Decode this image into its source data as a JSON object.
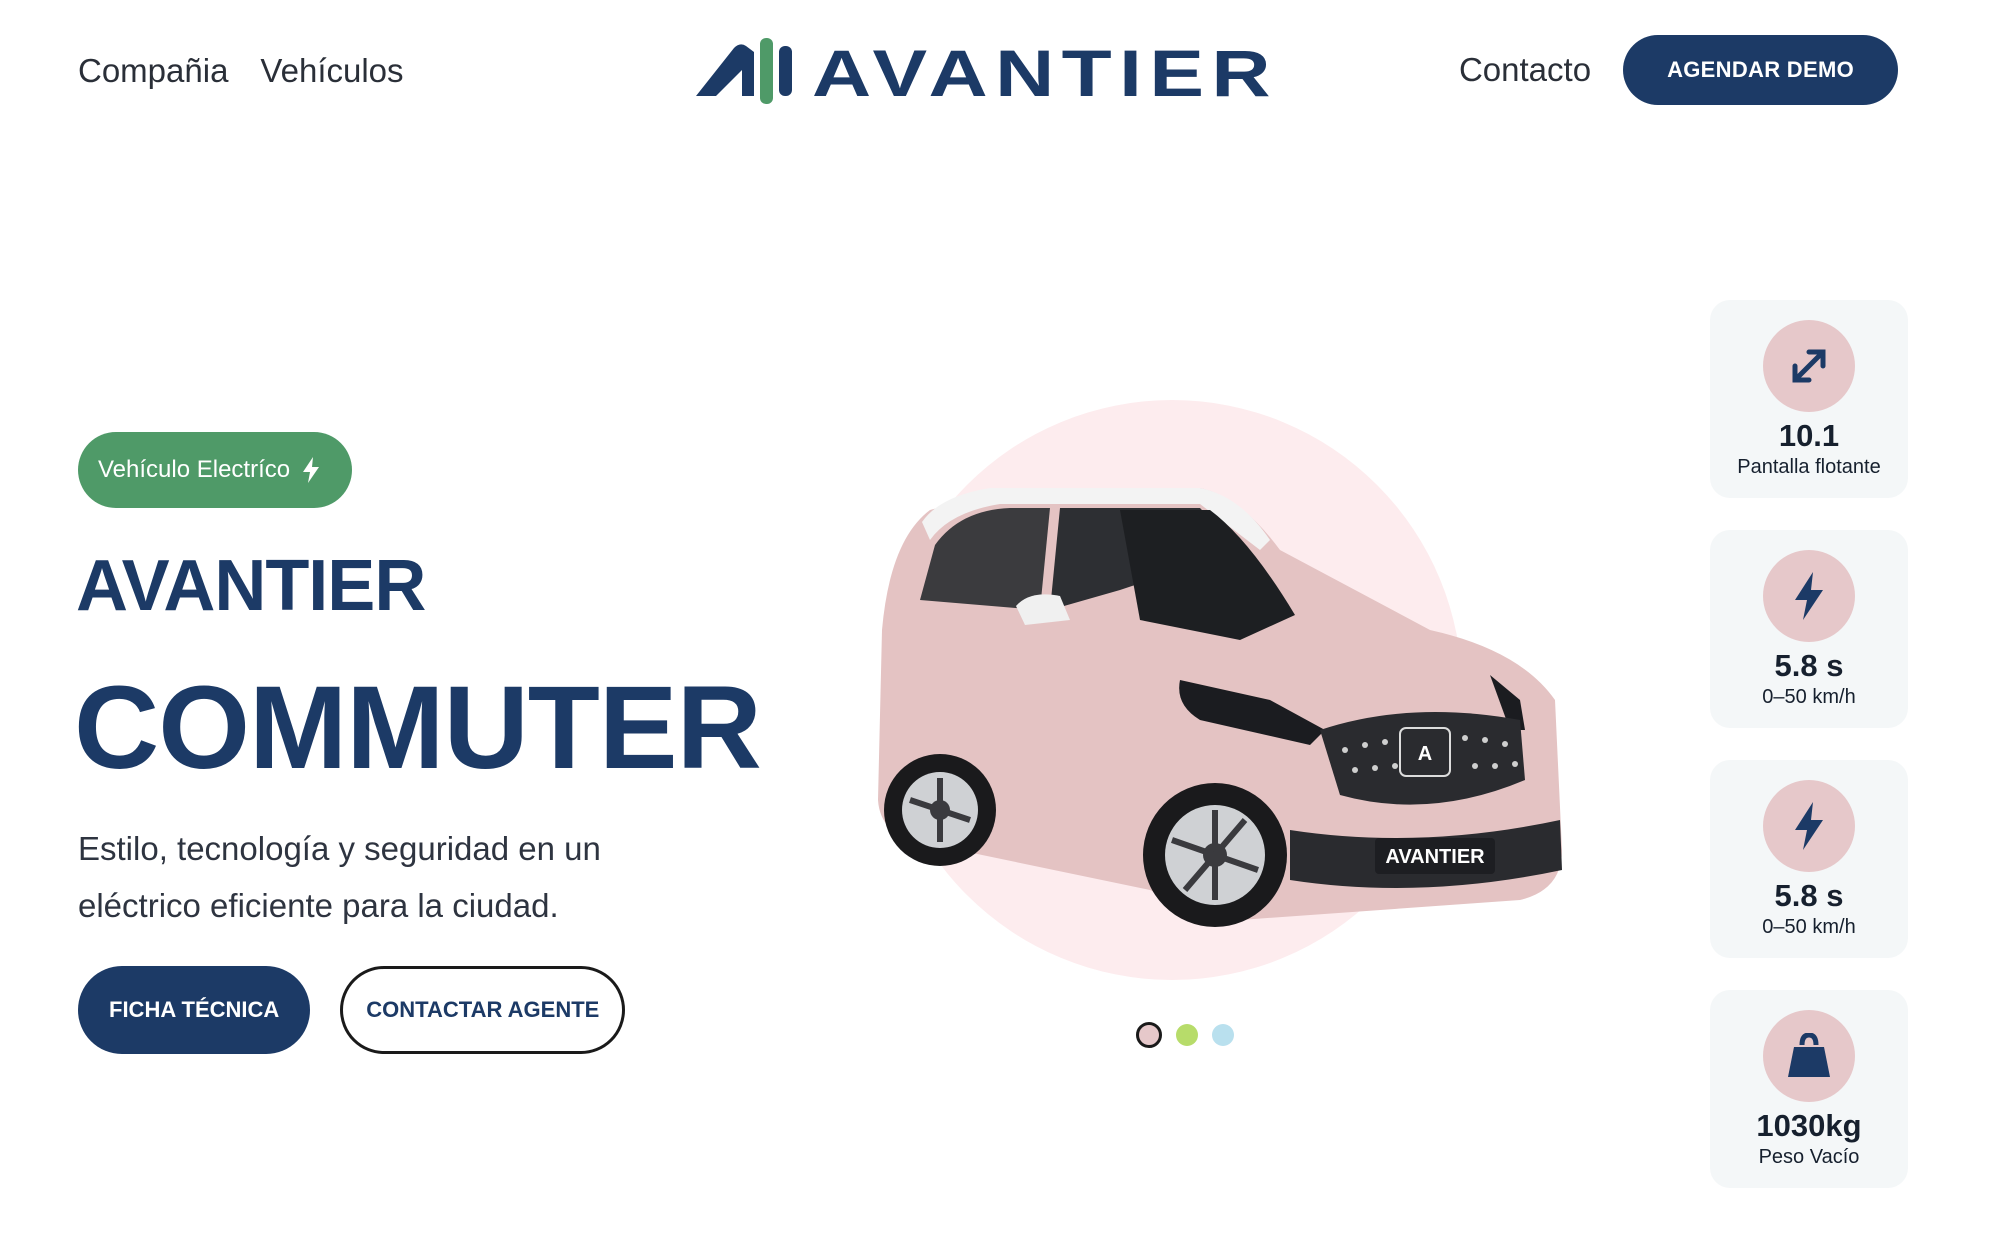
{
  "header": {
    "nav_left": [
      "Compañia",
      "Vehículos"
    ],
    "logo_text": "AVANTIER",
    "contact_label": "Contacto",
    "demo_button": "AGENDAR DEMO"
  },
  "hero": {
    "badge": "Vehículo Electríco",
    "brand": "AVANTIER",
    "model": "COMMUTER",
    "description": "Estilo, tecnología y seguridad en un eléctrico eficiente para la ciudad.",
    "primary_button": "FICHA TÉCNICA",
    "secondary_button": "CONTACTAR AGENTE",
    "plate_text": "AVANTIER"
  },
  "carousel": {
    "colors": [
      "#e6c8ca",
      "#b7dc6a",
      "#b9e0ee"
    ],
    "active_index": 0
  },
  "specs": [
    {
      "icon": "expand-arrows-icon",
      "value": "10.1",
      "label": "Pantalla flotante"
    },
    {
      "icon": "lightning-icon",
      "value": "5.8 s",
      "label": "0–50 km/h"
    },
    {
      "icon": "lightning-icon",
      "value": "5.8 s",
      "label": "0–50 km/h"
    },
    {
      "icon": "weight-icon",
      "value": "1030kg",
      "label": "Peso Vacío"
    }
  ],
  "colors": {
    "navy": "#1c3a66",
    "green": "#4f9a68",
    "pink": "#e6c8ca"
  }
}
